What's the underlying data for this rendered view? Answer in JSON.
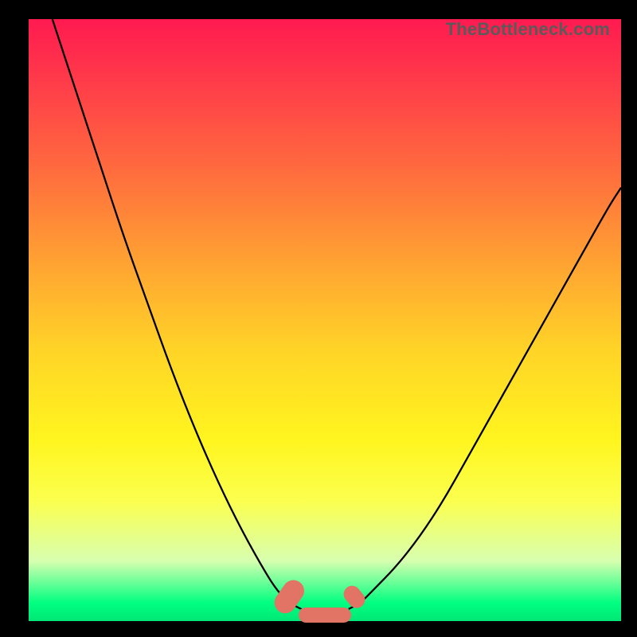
{
  "watermark": "TheBottleneck.com",
  "chart_data": {
    "type": "line",
    "title": "",
    "xlabel": "",
    "ylabel": "",
    "xlim": [
      0,
      100
    ],
    "ylim": [
      0,
      100
    ],
    "grid": false,
    "legend": false,
    "series": [
      {
        "name": "left-curve",
        "x": [
          4,
          8,
          12,
          16,
          20,
          24,
          28,
          32,
          36,
          40,
          42,
          44,
          46
        ],
        "y": [
          100,
          88,
          76,
          64,
          53,
          42,
          32,
          23,
          15,
          8,
          5,
          3,
          2
        ]
      },
      {
        "name": "right-curve",
        "x": [
          54,
          56,
          58,
          62,
          66,
          70,
          74,
          78,
          82,
          86,
          90,
          94,
          98,
          100
        ],
        "y": [
          2,
          3,
          5,
          9,
          14,
          20,
          27,
          34,
          41,
          48,
          55,
          62,
          69,
          72
        ]
      }
    ],
    "markers": [
      {
        "name": "left-blob",
        "cx": 44,
        "cy": 4,
        "rx": 3.0,
        "ry": 1.8,
        "angle": -55
      },
      {
        "name": "bottom-blob",
        "cx": 50,
        "cy": 1,
        "rx": 4.5,
        "ry": 1.2,
        "angle": 0
      },
      {
        "name": "right-blob",
        "cx": 55,
        "cy": 4,
        "rx": 2.0,
        "ry": 1.4,
        "angle": 50
      }
    ],
    "background_gradient": {
      "stops": [
        {
          "pos": 0,
          "color": "#ff1a50"
        },
        {
          "pos": 25,
          "color": "#ff6b3e"
        },
        {
          "pos": 55,
          "color": "#ffd427"
        },
        {
          "pos": 80,
          "color": "#fbff4e"
        },
        {
          "pos": 97,
          "color": "#00ff80"
        }
      ]
    }
  }
}
